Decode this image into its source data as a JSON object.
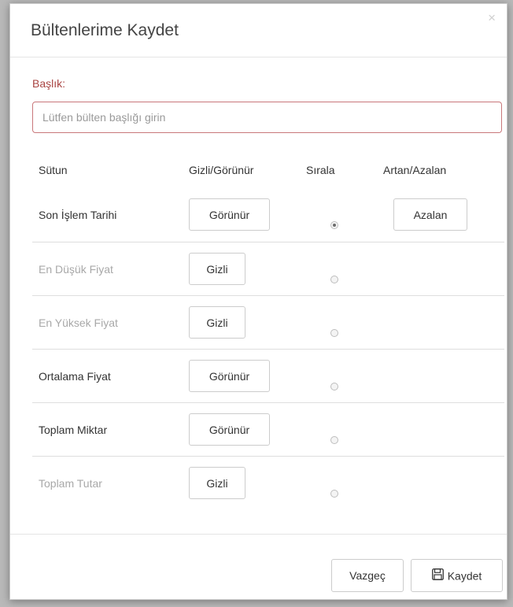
{
  "dialog": {
    "title": "Bültenlerime Kaydet",
    "close_symbol": "×"
  },
  "form": {
    "label": "Başlık:",
    "input_value": "",
    "input_placeholder": "Lütfen bülten başlığı girin"
  },
  "table": {
    "headers": [
      "Sütun",
      "Gizli/Görünür",
      "Sırala",
      "Artan/Azalan"
    ],
    "rows": [
      {
        "name": "Son İşlem Tarihi",
        "visibility": "Görünür",
        "sort_selected": true,
        "direction": "Azalan"
      },
      {
        "name": "En Düşük Fiyat",
        "visibility": "Gizli",
        "sort_selected": false,
        "direction": ""
      },
      {
        "name": "En Yüksek Fiyat",
        "visibility": "Gizli",
        "sort_selected": false,
        "direction": ""
      },
      {
        "name": "Ortalama Fiyat",
        "visibility": "Görünür",
        "sort_selected": false,
        "direction": ""
      },
      {
        "name": "Toplam Miktar",
        "visibility": "Görünür",
        "sort_selected": false,
        "direction": ""
      },
      {
        "name": "Toplam Tutar",
        "visibility": "Gizli",
        "sort_selected": false,
        "direction": ""
      }
    ]
  },
  "footer": {
    "cancel_label": "Vazgeç",
    "save_label": "Kaydet",
    "save_icon": "floppy-disk-icon"
  },
  "colors": {
    "label_red": "#a94442",
    "input_border": "#c9777a",
    "muted_text": "#a8a8a8"
  }
}
